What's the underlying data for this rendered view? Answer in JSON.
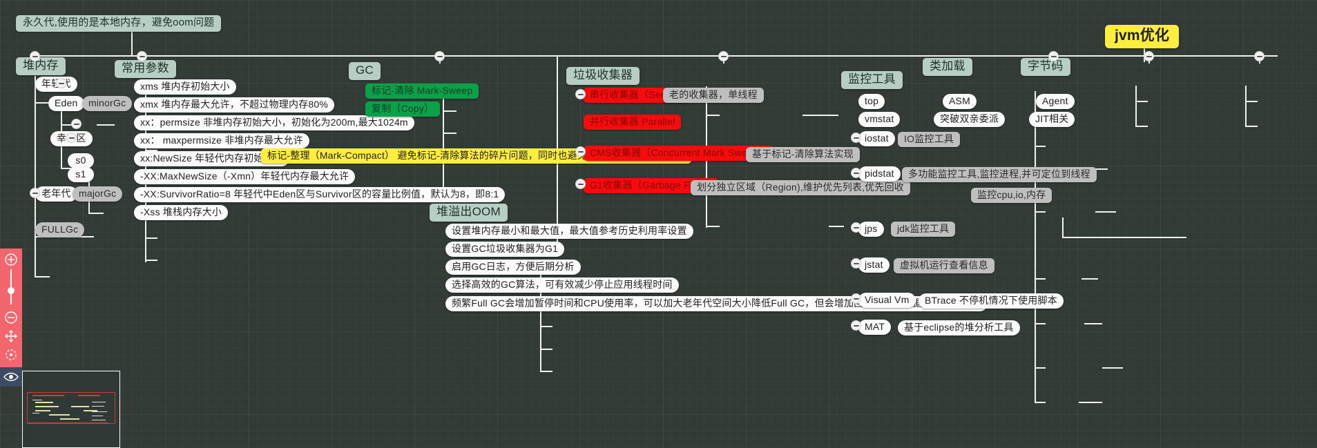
{
  "app": {
    "background_color": "#333b37",
    "accent_color": "#f4666e"
  },
  "root": {
    "label": "jvm优化",
    "color": "#fced3e"
  },
  "branches": {
    "perm": {
      "label": "永久代,使用的是本地内存，避免oom问题"
    },
    "heap_memory": {
      "label": "堆内存",
      "young": {
        "label": "年轻代",
        "eden": {
          "label": "Eden",
          "gc": "minorGc"
        },
        "survivor": {
          "label": "幸存区",
          "s0": "s0",
          "s1": "s1"
        }
      },
      "old": {
        "label": "老年代",
        "gc": "majorGc"
      },
      "fullgc": {
        "label": "FULLGc"
      }
    },
    "common_params": {
      "label": "常用参数",
      "items": [
        "xms 堆内存初始大小",
        "xmx 堆内存最大允许，不超过物理内存80%",
        "xx：permsize 非堆内存初始大小，初始化为200m,最大1024m",
        "xx： maxpermsize 非堆内存最大允许",
        "xx:NewSize 年轻代内存初始大小",
        "-XX:MaxNewSize（-Xmn）年轻代内存最大允许",
        "-XX:SurvivorRatio=8 年轻代中Eden区与Survivor区的容量比例值，默认为8，即8:1",
        "-Xss 堆栈内存大小"
      ]
    },
    "gc": {
      "label": "GC",
      "algos": [
        {
          "label": "标记-清除 Mark-Sweep",
          "color": "#0aa14a"
        },
        {
          "label": "复制（Copy）",
          "color": "#0aa14a"
        }
      ],
      "mark_compact": {
        "label": "标记-整理（Mark-Compact）   避免标记-清除算法的碎片问题，同时也避免了复制算法的空间问题",
        "color": "#fced3e"
      }
    },
    "oom": {
      "label": "堆溢出OOM",
      "items": [
        "设置堆内存最小和最大值，最大值参考历史利用率设置",
        "设置GC垃圾收集器为G1",
        "启用GC日志，方便后期分析",
        "选择高效的GC算法，可有效减少停止应用线程时间",
        "频繁Full GC会增加暂停时间和CPU使用率，可以加大老年代空间大小降低Full GC，但会增加回收时间，根据业务适当取舍"
      ]
    },
    "collectors": {
      "label": "垃圾收集器",
      "items": [
        {
          "label": "串行收集器（Serial）",
          "note": "老的收集器，单线程"
        },
        {
          "label": "并行收集器 Parallel",
          "note": ""
        },
        {
          "label": "CMS收集器（Concurrent Mark Sweep）",
          "note": "基于标记-清除算法实现"
        },
        {
          "label": "G1收集器（Garbage First）",
          "note": "划分独立区域（Region),维护优先列表,优先回收"
        }
      ]
    },
    "monitor_tools": {
      "label": "监控工具",
      "items": [
        {
          "label": "top",
          "notes": []
        },
        {
          "label": "vmstat",
          "notes": []
        },
        {
          "label": "iostat",
          "notes": [
            "IO监控工具"
          ]
        },
        {
          "label": "pidstat",
          "notes": [
            "多功能监控工具,监控进程,并可定位到线程",
            "监控cpu,io,内存"
          ]
        },
        {
          "label": "jps",
          "notes": [
            "jdk监控工具"
          ]
        },
        {
          "label": "jstat",
          "notes": [
            "虚拟机运行查看信息"
          ]
        },
        {
          "label": "Visual Vm",
          "notes": [
            "BTrace 不停机情况下使用脚本"
          ]
        },
        {
          "label": "MAT",
          "notes": [
            "基于eclipse的堆分析工具"
          ]
        }
      ]
    },
    "class_loading": {
      "label": "类加载",
      "items": [
        "ASM",
        "突破双亲委派"
      ]
    },
    "bytecode": {
      "label": "字节码",
      "items": [
        "Agent",
        "JIT相关"
      ]
    }
  },
  "toolbar": {
    "zoom_in": "zoom-in-icon",
    "zoom_slider": "zoom-slider",
    "zoom_out": "zoom-out-icon",
    "move": "move-icon",
    "center": "center-icon",
    "visibility": "eye-icon"
  },
  "minimap": {
    "name": "minimap"
  }
}
